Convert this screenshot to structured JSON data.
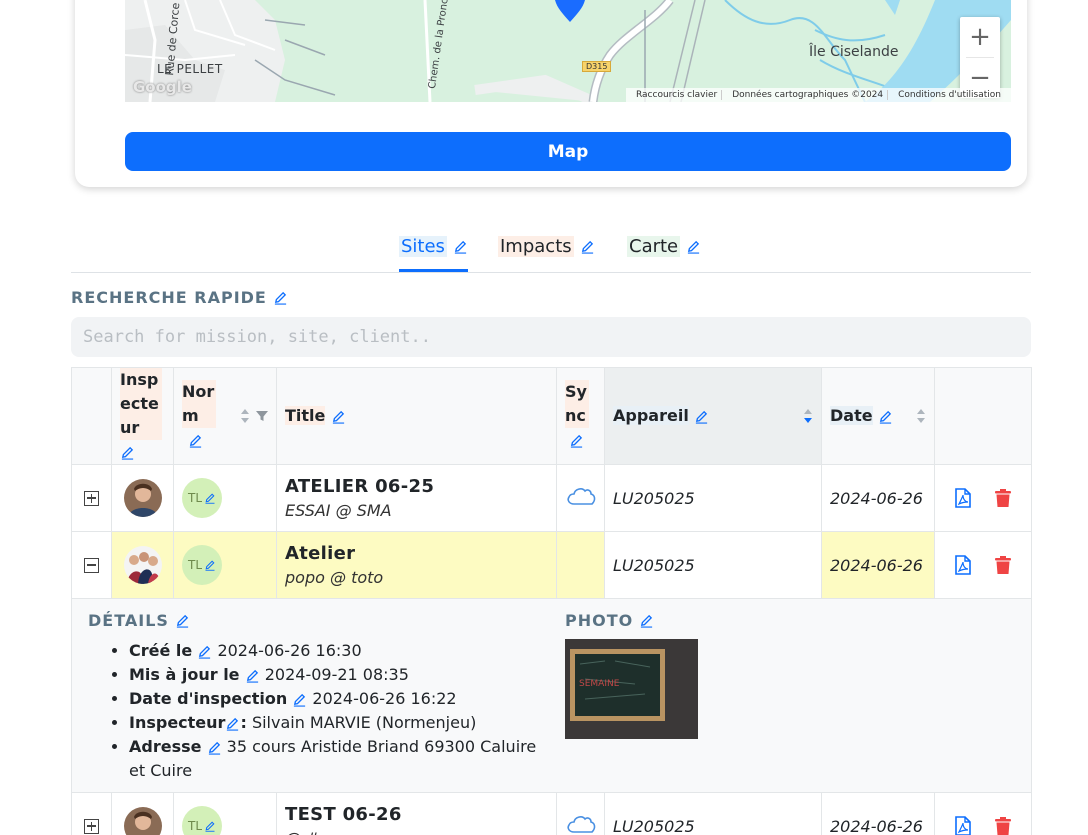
{
  "map": {
    "labels": {
      "rue_de_corcelles": "Rue de Corce",
      "le_pellet": "LE PELLET",
      "chemin": "Chem. de la Pronc",
      "ile": "Île Ciselande",
      "road": "D315"
    },
    "google": "Google",
    "zoom_in": "+",
    "zoom_out": "−",
    "attribution": {
      "shortcuts": "Raccourcis clavier",
      "data": "Données cartographiques ©2024",
      "terms": "Conditions d'utilisation"
    },
    "button_label": "Map",
    "colors": {
      "land": "#d8f1df",
      "water": "#9fdcf2",
      "primary": "#0d6efd"
    }
  },
  "tabs": [
    {
      "label": "Sites",
      "active": true
    },
    {
      "label": "Impacts",
      "active": false
    },
    {
      "label": "Carte",
      "active": false
    }
  ],
  "quick_search": {
    "title": "RECHERCHE RAPIDE",
    "placeholder": "Search for mission, site, client.."
  },
  "table": {
    "headers": {
      "inspecteur": "Insp ecte ur",
      "norm": "Nor m",
      "title": "Title",
      "sync": "Sy nc",
      "appareil": "Appareil",
      "date": "Date"
    },
    "rows": [
      {
        "badge": "TL",
        "title": "ATELIER 06-25",
        "subtitle": "ESSAI @ SMA",
        "appareil": "LU205025",
        "date": "2024-06-26",
        "expanded": false,
        "synced": true
      },
      {
        "badge": "TL",
        "title": "Atelier",
        "subtitle": "popo @ toto",
        "appareil": "LU205025",
        "date": "2024-06-26",
        "expanded": true,
        "synced": false
      },
      {
        "badge": "TL",
        "title": "TEST 06-26",
        "subtitle": "@ #",
        "appareil": "LU205025",
        "date": "2024-06-26",
        "expanded": false,
        "synced": true
      }
    ],
    "details": {
      "title": "DÉTAILS",
      "photo_title": "PHOTO",
      "items": [
        {
          "label": "Créé le",
          "value": "2024-06-26 16:30"
        },
        {
          "label": "Mis à jour le",
          "value": "2024-09-21 08:35"
        },
        {
          "label": "Date d'inspection",
          "value": "2024-06-26 16:22"
        },
        {
          "label": "Inspecteur",
          "value": "Silvain MARVIE (Normenjeu)"
        },
        {
          "label": "Adresse",
          "value": "35 cours Aristide Briand 69300 Caluire et Cuire"
        }
      ],
      "photo_text": "SEMAINE"
    },
    "icon_colors": {
      "pdf": "#0d6efd",
      "trash": "#ef4444",
      "cloud": "#4a90e2"
    }
  }
}
